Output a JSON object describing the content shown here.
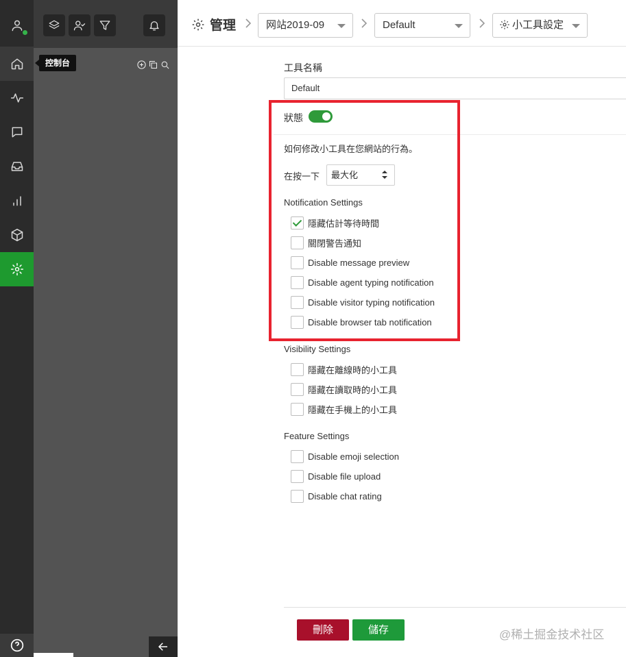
{
  "sidebar": {
    "tooltip": "控制台",
    "items": [
      {
        "name": "home",
        "icon": "home-icon"
      },
      {
        "name": "activity",
        "icon": "activity-icon"
      },
      {
        "name": "chat",
        "icon": "chat-icon"
      },
      {
        "name": "inbox",
        "icon": "inbox-icon"
      },
      {
        "name": "reports",
        "icon": "bar-chart-icon"
      },
      {
        "name": "apps",
        "icon": "box-icon"
      },
      {
        "name": "settings",
        "icon": "gear-icon",
        "active": true
      }
    ]
  },
  "header": {
    "title": "管理",
    "site_select": "网站2019-09",
    "department_select": "Default",
    "widget_select": "小工具設定"
  },
  "form": {
    "tool_name_label": "工具名稱",
    "tool_name_value": "Default",
    "status_label": "狀態",
    "status_on": true,
    "behavior_desc": "如何修改小工具在您網站的行為。",
    "on_click_label": "在按一下",
    "on_click_value": "最大化",
    "notification_title": "Notification Settings",
    "notification_items": [
      {
        "label": "隱藏估計等待時間",
        "checked": true
      },
      {
        "label": "關閉警告通知",
        "checked": false
      },
      {
        "label": "Disable message preview",
        "checked": false
      },
      {
        "label": "Disable agent typing notification",
        "checked": false
      },
      {
        "label": "Disable visitor typing notification",
        "checked": false
      },
      {
        "label": "Disable browser tab notification",
        "checked": false
      }
    ],
    "visibility_title": "Visibility Settings",
    "visibility_items": [
      {
        "label": "隱藏在離線時的小工具",
        "checked": false
      },
      {
        "label": "隱藏在讀取時的小工具",
        "checked": false
      },
      {
        "label": "隱藏在手機上的小工具",
        "checked": false
      }
    ],
    "feature_title": "Feature Settings",
    "feature_items": [
      {
        "label": "Disable emoji selection",
        "checked": false
      },
      {
        "label": "Disable file upload",
        "checked": false
      },
      {
        "label": "Disable chat rating",
        "checked": false
      }
    ]
  },
  "buttons": {
    "delete": "刪除",
    "save": "儲存"
  },
  "watermark": "@稀土掘金技术社区",
  "colors": {
    "accent": "#1e9a3a",
    "danger": "#a8102b",
    "highlight": "#e8232f",
    "rail": "#2b2b2b",
    "panel": "#535353"
  }
}
